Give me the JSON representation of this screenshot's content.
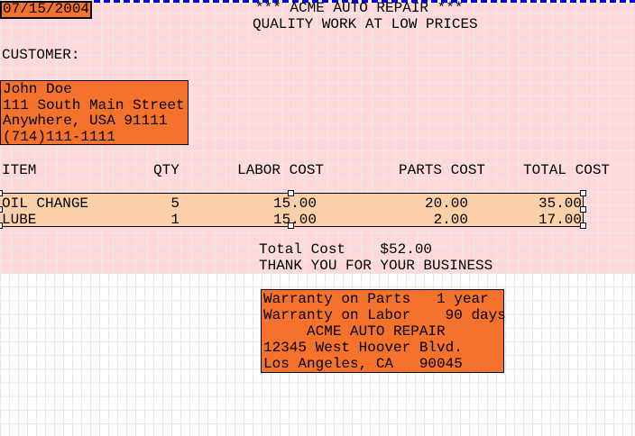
{
  "report": {
    "date_field": "07/15/2004",
    "header": {
      "title_line1": "*** ACME AUTO REPAIR ***",
      "title_line2": "QUALITY WORK AT LOW PRICES"
    },
    "customer_label": "CUSTOMER:",
    "customer_box": {
      "name": "John Doe",
      "street": "111 South Main Street",
      "city": "Anywhere, USA 91111",
      "phone": "(714)111-1111"
    },
    "table": {
      "headers": [
        "ITEM",
        "QTY",
        "LABOR COST",
        "PARTS COST",
        "TOTAL COST"
      ],
      "rows": [
        {
          "item": "OIL CHANGE",
          "qty": "5",
          "labor": "15.00",
          "parts": "20.00",
          "total": "35.00"
        },
        {
          "item": "LUBE",
          "qty": "1",
          "labor": "15.00",
          "parts": "2.00",
          "total": "17.00"
        }
      ]
    },
    "summary": {
      "total_line": "Total Cost    $52.00",
      "thanks_line": "THANK YOU FOR YOUR BUSINESS"
    },
    "warranty_box": {
      "line1": "Warranty on Parts   1 year",
      "line2": "Warranty on Labor    90 days",
      "line3": "     ACME AUTO REPAIR",
      "line4": "12345 West Hoover Blvd.",
      "line5": "Los Angeles, CA   90045"
    },
    "colors": {
      "field_orange": "#f4722c",
      "selected_band_fill": "#fbcfa8",
      "page_pink": "#ffd9d9",
      "separator_blue": "#0000ee"
    }
  }
}
